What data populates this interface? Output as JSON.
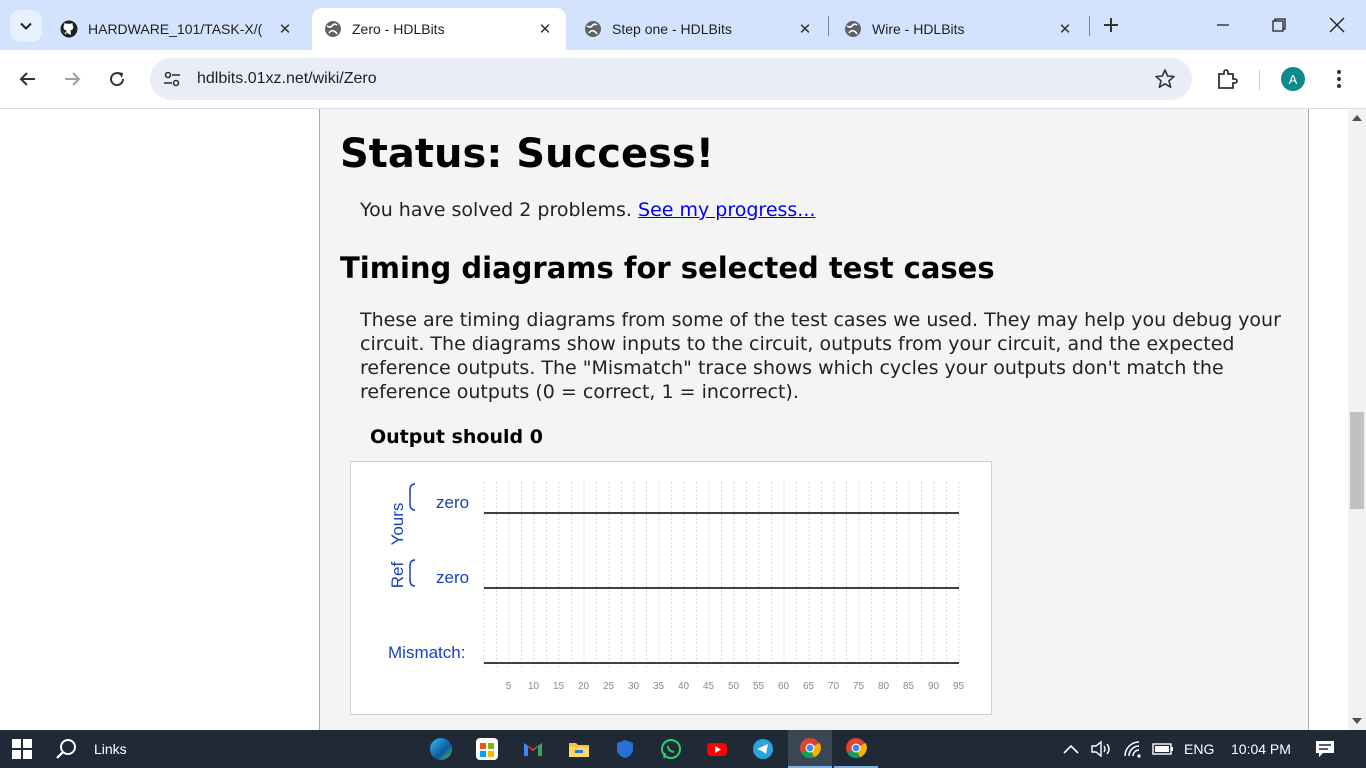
{
  "browser": {
    "tabs": [
      {
        "title": "HARDWARE_101/TASK-X/(",
        "icon": "github-icon",
        "active": false
      },
      {
        "title": "Zero - HDLBits",
        "icon": "globe-icon",
        "active": true
      },
      {
        "title": "Step one - HDLBits",
        "icon": "globe-icon",
        "active": false
      },
      {
        "title": "Wire - HDLBits",
        "icon": "globe-icon",
        "active": false
      }
    ],
    "url": "hdlbits.01xz.net/wiki/Zero",
    "profile_initial": "A"
  },
  "page": {
    "status_title": "Status: Success!",
    "solved_text": "You have solved 2 problems.",
    "progress_link": "See my progress...",
    "timing_heading": "Timing diagrams for selected test cases",
    "description": "These are timing diagrams from some of the test cases we used. They may help you debug your circuit. The diagrams show inputs to the circuit, outputs from your circuit, and the expected reference outputs. The \"Mismatch\" trace shows which cycles your outputs don't match the reference outputs (0 = correct, 1 = incorrect).",
    "test_case_title": "Output should 0"
  },
  "waveform": {
    "groups": [
      {
        "label": "Yours",
        "signal": "zero",
        "value": 0
      },
      {
        "label": "Ref",
        "signal": "zero",
        "value": 0
      }
    ],
    "mismatch_label": "Mismatch:",
    "mismatch_value": 0,
    "ticks": [
      5,
      10,
      15,
      20,
      25,
      30,
      35,
      40,
      45,
      50,
      55,
      60,
      65,
      70,
      75,
      80,
      85,
      90,
      95
    ],
    "color_label": "#1a3fbf"
  },
  "taskbar": {
    "search_label": "Links",
    "language": "ENG",
    "time": "10:04 PM",
    "apps": [
      "edge-icon",
      "store-icon",
      "gmail-icon",
      "file-explorer-icon",
      "defender-icon",
      "whatsapp-icon",
      "youtube-icon",
      "telegram-icon",
      "chrome-icon",
      "chrome-icon"
    ]
  }
}
